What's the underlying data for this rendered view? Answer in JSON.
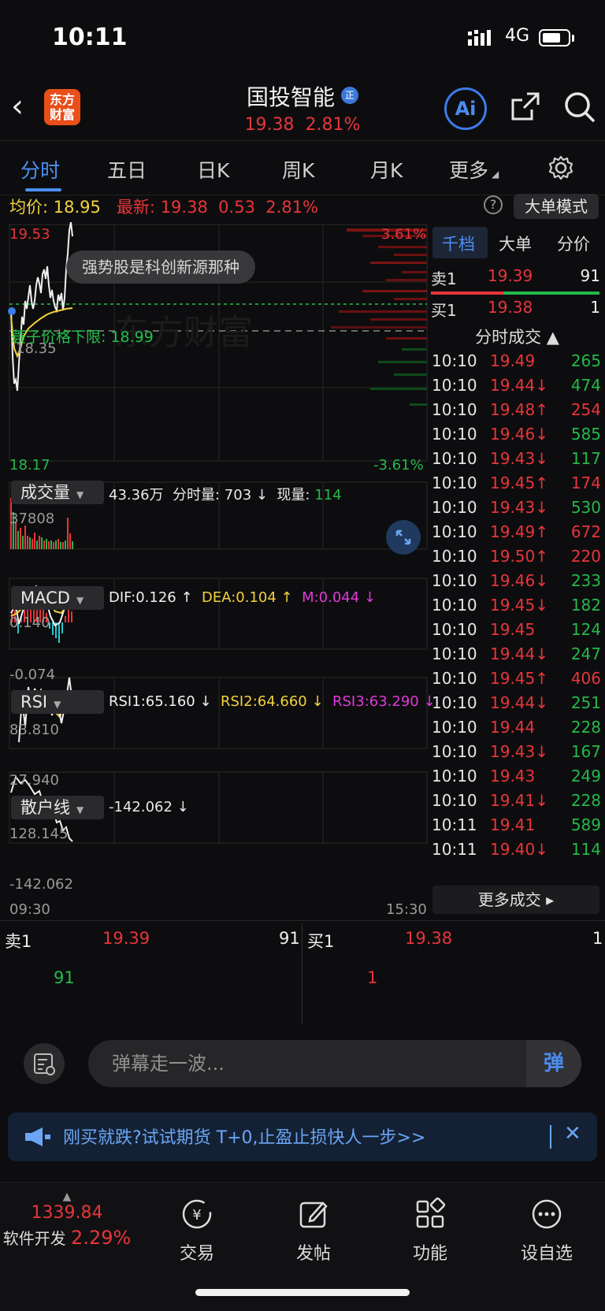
{
  "status_bar": {
    "time": "10:11",
    "network": "4G"
  },
  "header": {
    "logo_text": "东方财富",
    "title": "国投智能",
    "title_badge": "正",
    "price": "19.38",
    "change_pct": "2.81%",
    "ai_label": "Ai"
  },
  "tabs": [
    "分时",
    "五日",
    "日K",
    "周K",
    "月K",
    "更多"
  ],
  "info": {
    "avg_label": "均价:",
    "avg_value": "18.95",
    "latest_label": "最新:",
    "latest_value": "19.38",
    "change": "0.53",
    "change_pct": "2.81%",
    "big_order_mode": "大单模式",
    "help": "?"
  },
  "price_axis": {
    "high": "19.53",
    "low": "18.17",
    "high_pct": "3.61%",
    "low_pct": "-3.61%",
    "mid_left": "18.35"
  },
  "hint_bubble": "强势股是科创新源那种",
  "watermark": "东方财富",
  "limit_label": "蓑子价格下限:  18.99",
  "volume_panel": {
    "button": "成交量",
    "total": "43.36万",
    "tick_label": "分时量:",
    "tick_value": "703",
    "now_label": "现量:",
    "now_value": "114",
    "axis_max": "37808"
  },
  "macd_panel": {
    "button": "MACD",
    "dif": "DIF:0.126 ↑",
    "dea": "DEA:0.104 ↑",
    "m": "M:0.044 ↓",
    "axis_max": "0.140",
    "axis_min": "-0.074"
  },
  "rsi_panel": {
    "button": "RSI",
    "rsi1": "RSI1:65.160 ↓",
    "rsi2": "RSI2:64.660 ↓",
    "rsi3": "RSI3:63.290 ↓",
    "axis_max": "83.810",
    "axis_min": "27.940"
  },
  "retail_panel": {
    "button": "散户线",
    "value": "-142.062 ↓",
    "axis_max": "128.145",
    "axis_min": "-142.062"
  },
  "time_axis": {
    "start": "09:30",
    "end": "15:30"
  },
  "right_panel": {
    "tabs": [
      "千档",
      "大单",
      "分价"
    ],
    "sell1": {
      "label": "卖1",
      "price": "19.39",
      "vol": "91"
    },
    "buy1": {
      "label": "买1",
      "price": "19.38",
      "vol": "1"
    },
    "ticks_header": "分时成交 ▲",
    "ticks": [
      {
        "t": "10:10",
        "p": "19.49",
        "v": "265",
        "pc": "red",
        "vc": "green"
      },
      {
        "t": "10:10",
        "p": "19.44↓",
        "v": "474",
        "pc": "red",
        "vc": "green"
      },
      {
        "t": "10:10",
        "p": "19.48↑",
        "v": "254",
        "pc": "red",
        "vc": "red"
      },
      {
        "t": "10:10",
        "p": "19.46↓",
        "v": "585",
        "pc": "red",
        "vc": "green"
      },
      {
        "t": "10:10",
        "p": "19.43↓",
        "v": "117",
        "pc": "red",
        "vc": "green"
      },
      {
        "t": "10:10",
        "p": "19.45↑",
        "v": "174",
        "pc": "red",
        "vc": "red"
      },
      {
        "t": "10:10",
        "p": "19.43↓",
        "v": "530",
        "pc": "red",
        "vc": "green"
      },
      {
        "t": "10:10",
        "p": "19.49↑",
        "v": "672",
        "pc": "red",
        "vc": "red"
      },
      {
        "t": "10:10",
        "p": "19.50↑",
        "v": "220",
        "pc": "red",
        "vc": "red"
      },
      {
        "t": "10:10",
        "p": "19.46↓",
        "v": "233",
        "pc": "red",
        "vc": "green"
      },
      {
        "t": "10:10",
        "p": "19.45↓",
        "v": "182",
        "pc": "red",
        "vc": "green"
      },
      {
        "t": "10:10",
        "p": "19.45",
        "v": "124",
        "pc": "red",
        "vc": "green"
      },
      {
        "t": "10:10",
        "p": "19.44↓",
        "v": "247",
        "pc": "red",
        "vc": "green"
      },
      {
        "t": "10:10",
        "p": "19.45↑",
        "v": "406",
        "pc": "red",
        "vc": "red"
      },
      {
        "t": "10:10",
        "p": "19.44↓",
        "v": "251",
        "pc": "red",
        "vc": "green"
      },
      {
        "t": "10:10",
        "p": "19.44",
        "v": "228",
        "pc": "red",
        "vc": "green"
      },
      {
        "t": "10:10",
        "p": "19.43↓",
        "v": "167",
        "pc": "red",
        "vc": "green"
      },
      {
        "t": "10:10",
        "p": "19.43",
        "v": "249",
        "pc": "red",
        "vc": "green"
      },
      {
        "t": "10:10",
        "p": "19.41↓",
        "v": "228",
        "pc": "red",
        "vc": "green"
      },
      {
        "t": "10:11",
        "p": "19.41",
        "v": "589",
        "pc": "red",
        "vc": "green"
      },
      {
        "t": "10:11",
        "p": "19.40↓",
        "v": "114",
        "pc": "red",
        "vc": "green"
      }
    ],
    "more": "更多成交 ▸"
  },
  "order_book_bottom": {
    "sell_label": "卖1",
    "sell_price": "19.39",
    "sell_vol": "91",
    "sell_detail": "91",
    "buy_label": "买1",
    "buy_price": "19.38",
    "buy_vol": "1",
    "buy_detail": "1"
  },
  "danmu": {
    "placeholder": "弹幕走一波...",
    "send": "弹"
  },
  "ad": {
    "text": "刚买就跌?试试期货 T+0,止盈止损快人一步>>",
    "close": "✕"
  },
  "bottom_nav": {
    "index_value": "1339.84",
    "index_name": "软件开发",
    "index_pct": "2.29%",
    "items": [
      "交易",
      "发帖",
      "功能",
      "设自选"
    ]
  },
  "colors": {
    "up": "#e8353a",
    "down": "#25b84a",
    "accent": "#4d8ff5",
    "avg_line": "#f3d23c",
    "bg": "#0d0d0f"
  }
}
